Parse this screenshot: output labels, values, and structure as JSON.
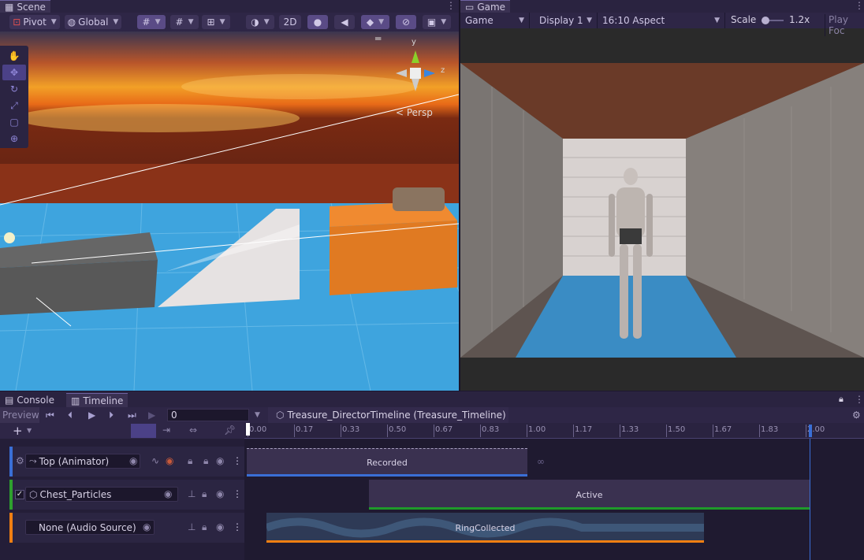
{
  "scene_panel": {
    "tab_label": "Scene",
    "pivot_label": "Pivot",
    "global_label": "Global",
    "mode_2d_label": "2D",
    "persp_label": "< Persp",
    "axis_y": "y",
    "axis_z": "z"
  },
  "game_panel": {
    "tab_label": "Game",
    "display_mode": "Game",
    "display": "Display 1",
    "aspect": "16:10 Aspect",
    "scale_label": "Scale",
    "scale_value": "1.2x",
    "play_focused_label": "Play Foc"
  },
  "bottom_panel": {
    "console_tab": "Console",
    "timeline_tab": "Timeline",
    "preview_label": "Preview",
    "frame_value": "0",
    "asset_path": "Treasure_DirectorTimeline (Treasure_Timeline)"
  },
  "ruler": {
    "ticks": [
      "0.00",
      "0.17",
      "0.33",
      "0.50",
      "0.67",
      "0.83",
      "1.00",
      "1.17",
      "1.33",
      "1.50",
      "1.67",
      "1.83",
      "2.00"
    ]
  },
  "tracks": [
    {
      "label": "Top (Animator)",
      "color": "#3a6fd6",
      "clip_label": "Recorded",
      "clip_color": "#3a6fd6"
    },
    {
      "label": "Chest_Particles",
      "color": "#2ea02e",
      "clip_label": "Active",
      "clip_color": "#1f9a2a"
    },
    {
      "label": "None (Audio Source)",
      "color": "#f07f12",
      "clip_label": "RingCollected",
      "clip_color": "#f07f12"
    }
  ]
}
